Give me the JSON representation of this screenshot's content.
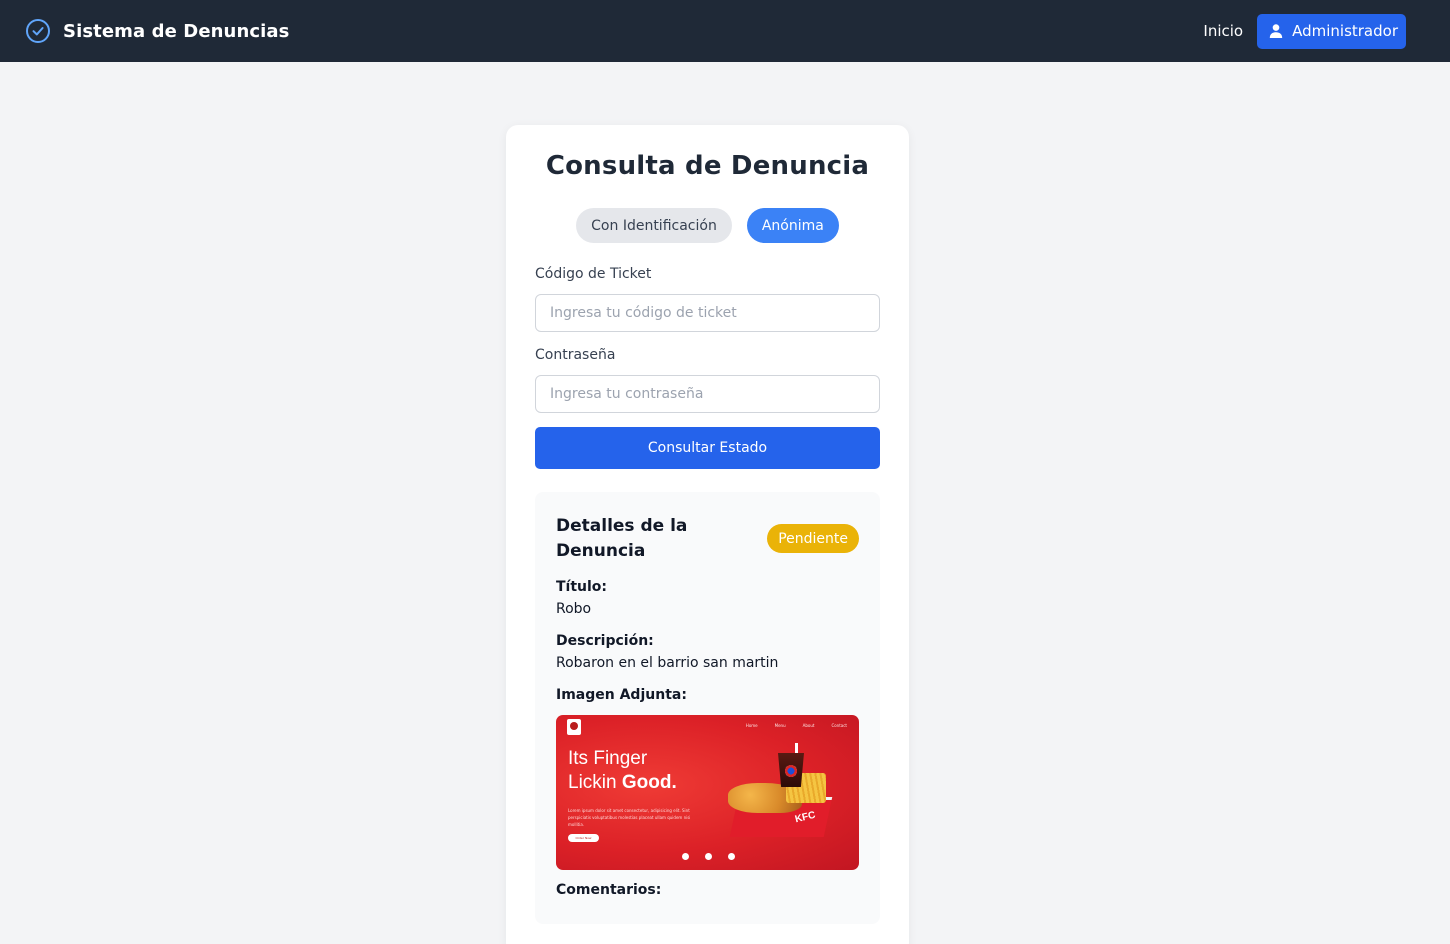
{
  "navbar": {
    "brand": "Sistema de Denuncias",
    "inicio": "Inicio",
    "admin_label": "Administrador"
  },
  "card": {
    "title": "Consulta de Denuncia",
    "tabs": [
      {
        "label": "Con Identificación",
        "active": false
      },
      {
        "label": "Anónima",
        "active": true
      }
    ],
    "ticket_label": "Código de Ticket",
    "ticket_placeholder": "Ingresa tu código de ticket",
    "password_label": "Contraseña",
    "password_placeholder": "Ingresa tu contraseña",
    "submit_label": "Consultar Estado"
  },
  "details": {
    "title": "Detalles de la Denuncia",
    "status": "Pendiente",
    "titulo_label": "Título:",
    "titulo_value": "Robo",
    "descripcion_label": "Descripción:",
    "descripcion_value": "Robaron en el barrio san martin",
    "imagen_label": "Imagen Adjunta:",
    "comentarios_label": "Comentarios:",
    "attachment": {
      "headline_line1": "Its Finger",
      "headline_line2_a": "Lickin ",
      "headline_line2_b": "Good.",
      "box_label": "KFC",
      "nav": [
        "Home",
        "Menu",
        "About",
        "Contact"
      ],
      "paragraph": "Lorem ipsum dolor sit amet consectetur, adipisicing elit. Sint perspiciatis voluptatibus molestias placeat ullam quidem nisi mollitia.",
      "button": "Order Now"
    }
  },
  "colors": {
    "navbar_bg": "#1f2937",
    "primary": "#2563eb",
    "tab_active": "#3b82f6",
    "badge_pending": "#eab308"
  }
}
